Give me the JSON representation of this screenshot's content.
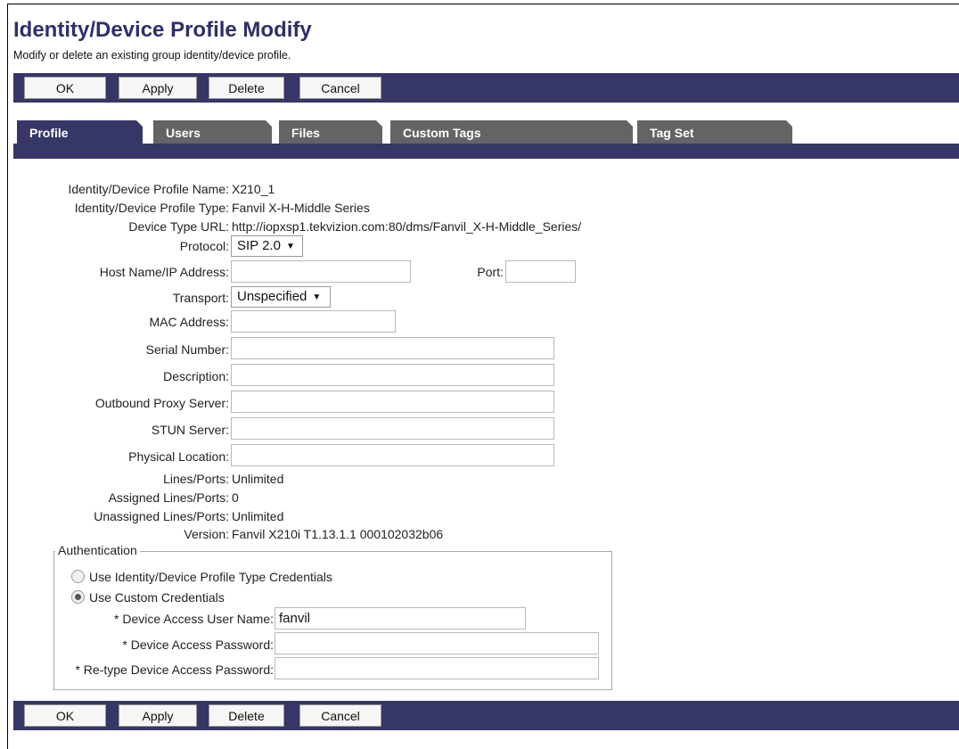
{
  "header": {
    "title": "Identity/Device Profile Modify",
    "subtitle": "Modify or delete an existing group identity/device profile."
  },
  "buttons": {
    "ok": "OK",
    "apply": "Apply",
    "delete": "Delete",
    "cancel": "Cancel"
  },
  "tabs": [
    {
      "label": "Profile",
      "active": true
    },
    {
      "label": "Users"
    },
    {
      "label": "Files"
    },
    {
      "label": "Custom Tags"
    },
    {
      "label": "Tag Set"
    }
  ],
  "profile": {
    "name_label": "Identity/Device Profile Name:",
    "name_value": "X210_1",
    "type_label": "Identity/Device Profile Type:",
    "type_value": "Fanvil X-H-Middle Series",
    "url_label": "Device Type URL:",
    "url_value": "http://iopxsp1.tekvizion.com:80/dms/Fanvil_X-H-Middle_Series/",
    "protocol_label": "Protocol:",
    "protocol_value": "SIP 2.0",
    "host_label": "Host Name/IP Address:",
    "host_value": "",
    "port_label": "Port:",
    "port_value": "",
    "transport_label": "Transport:",
    "transport_value": "Unspecified",
    "mac_label": "MAC Address:",
    "mac_value": "",
    "serial_label": "Serial Number:",
    "serial_value": "",
    "description_label": "Description:",
    "description_value": "",
    "proxy_label": "Outbound Proxy Server:",
    "proxy_value": "",
    "stun_label": "STUN Server:",
    "stun_value": "",
    "location_label": "Physical Location:",
    "location_value": "",
    "lines_label": "Lines/Ports:",
    "lines_value": "Unlimited",
    "assigned_label": "Assigned Lines/Ports:",
    "assigned_value": "0",
    "unassigned_label": "Unassigned Lines/Ports:",
    "unassigned_value": "Unlimited",
    "version_label": "Version:",
    "version_value": "Fanvil X210i T1.13.1.1 000102032b06"
  },
  "auth": {
    "legend": "Authentication",
    "option_type": "Use Identity/Device Profile Type Credentials",
    "option_custom": "Use Custom Credentials",
    "selected": "custom",
    "user_label": "* Device Access User Name:",
    "user_value": "fanvil",
    "pass_label": "* Device Access Password:",
    "pass_value": "",
    "retype_label": "* Re-type Device Access Password:",
    "retype_value": ""
  },
  "colors": {
    "bar": "#363667",
    "title": "#2f2f69",
    "tab_inactive": "#646464"
  }
}
